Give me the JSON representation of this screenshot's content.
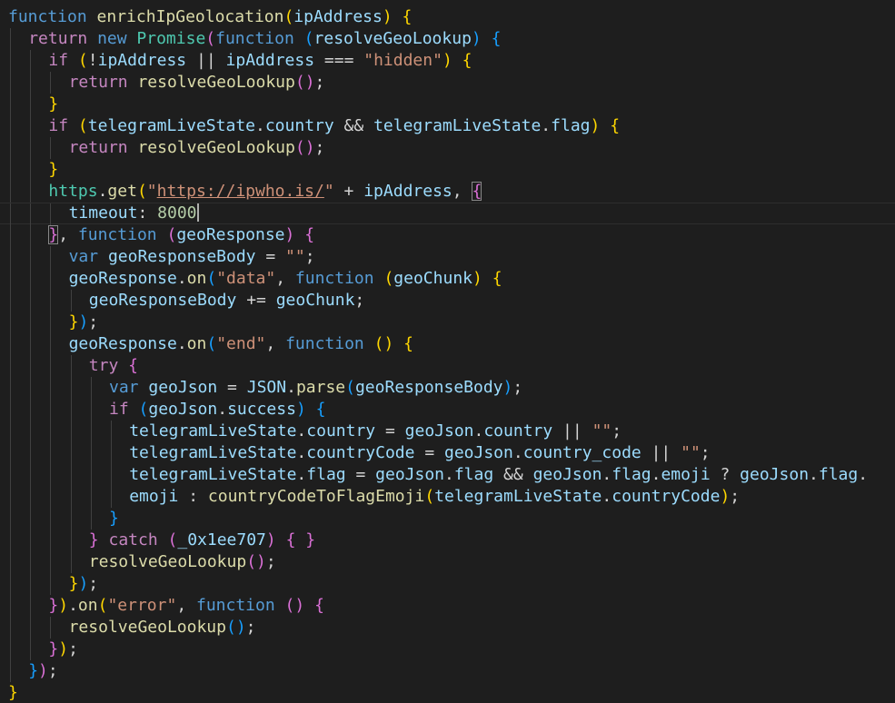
{
  "colors": {
    "background": "#1e1e1e",
    "keyword": "#569cd6",
    "control": "#c586c0",
    "function": "#dcdcaa",
    "variable": "#9cdcfe",
    "string": "#ce9178",
    "number": "#b5cea8",
    "class": "#4ec9b0",
    "plain": "#d4d4d4",
    "bracket1": "#ffd700",
    "bracket2": "#da70d6",
    "bracket3": "#179fff"
  },
  "editor": {
    "cursor_line": 10,
    "lines": [
      {
        "indent": 0,
        "tokens": [
          [
            "function",
            "keyword"
          ],
          [
            " ",
            "plain"
          ],
          [
            "enrichIpGeolocation",
            "function"
          ],
          [
            "(",
            "bracket1"
          ],
          [
            "ipAddress",
            "variable"
          ],
          [
            ")",
            "bracket1"
          ],
          [
            " ",
            "plain"
          ],
          [
            "{",
            "bracket1"
          ]
        ]
      },
      {
        "indent": 1,
        "tokens": [
          [
            "return",
            "control"
          ],
          [
            " ",
            "plain"
          ],
          [
            "new",
            "keyword"
          ],
          [
            " ",
            "plain"
          ],
          [
            "Promise",
            "class"
          ],
          [
            "(",
            "bracket2"
          ],
          [
            "function",
            "keyword"
          ],
          [
            " ",
            "plain"
          ],
          [
            "(",
            "bracket3"
          ],
          [
            "resolveGeoLookup",
            "variable"
          ],
          [
            ")",
            "bracket3"
          ],
          [
            " ",
            "plain"
          ],
          [
            "{",
            "bracket3"
          ]
        ]
      },
      {
        "indent": 2,
        "tokens": [
          [
            "if",
            "control"
          ],
          [
            " ",
            "plain"
          ],
          [
            "(",
            "bracket1"
          ],
          [
            "!",
            "plain"
          ],
          [
            "ipAddress",
            "variable"
          ],
          [
            " || ",
            "plain"
          ],
          [
            "ipAddress",
            "variable"
          ],
          [
            " === ",
            "plain"
          ],
          [
            "\"hidden\"",
            "string"
          ],
          [
            ")",
            "bracket1"
          ],
          [
            " ",
            "plain"
          ],
          [
            "{",
            "bracket1"
          ]
        ]
      },
      {
        "indent": 3,
        "tokens": [
          [
            "return",
            "control"
          ],
          [
            " ",
            "plain"
          ],
          [
            "resolveGeoLookup",
            "function"
          ],
          [
            "()",
            "bracket2"
          ],
          [
            ";",
            "plain"
          ]
        ]
      },
      {
        "indent": 2,
        "tokens": [
          [
            "}",
            "bracket1"
          ]
        ]
      },
      {
        "indent": 2,
        "tokens": [
          [
            "if",
            "control"
          ],
          [
            " ",
            "plain"
          ],
          [
            "(",
            "bracket1"
          ],
          [
            "telegramLiveState",
            "variable"
          ],
          [
            ".",
            "plain"
          ],
          [
            "country",
            "variable"
          ],
          [
            " && ",
            "plain"
          ],
          [
            "telegramLiveState",
            "variable"
          ],
          [
            ".",
            "plain"
          ],
          [
            "flag",
            "variable"
          ],
          [
            ")",
            "bracket1"
          ],
          [
            " ",
            "plain"
          ],
          [
            "{",
            "bracket1"
          ]
        ]
      },
      {
        "indent": 3,
        "tokens": [
          [
            "return",
            "control"
          ],
          [
            " ",
            "plain"
          ],
          [
            "resolveGeoLookup",
            "function"
          ],
          [
            "()",
            "bracket2"
          ],
          [
            ";",
            "plain"
          ]
        ]
      },
      {
        "indent": 2,
        "tokens": [
          [
            "}",
            "bracket1"
          ]
        ]
      },
      {
        "indent": 2,
        "tokens": [
          [
            "https",
            "class"
          ],
          [
            ".",
            "plain"
          ],
          [
            "get",
            "function"
          ],
          [
            "(",
            "bracket1"
          ],
          [
            "\"",
            "string"
          ],
          [
            "https://ipwho.is/",
            "string-underline"
          ],
          [
            "\"",
            "string"
          ],
          [
            " + ",
            "plain"
          ],
          [
            "ipAddress",
            "variable"
          ],
          [
            ", ",
            "plain"
          ],
          [
            "{",
            "bracket2-box"
          ]
        ]
      },
      {
        "indent": 3,
        "tokens": [
          [
            "timeout",
            "variable"
          ],
          [
            ": ",
            "plain"
          ],
          [
            "8000",
            "number"
          ]
        ]
      },
      {
        "indent": 2,
        "tokens": [
          [
            "}",
            "bracket2-box"
          ],
          [
            ", ",
            "plain"
          ],
          [
            "function",
            "keyword"
          ],
          [
            " ",
            "plain"
          ],
          [
            "(",
            "bracket2"
          ],
          [
            "geoResponse",
            "variable"
          ],
          [
            ")",
            "bracket2"
          ],
          [
            " ",
            "plain"
          ],
          [
            "{",
            "bracket2"
          ]
        ]
      },
      {
        "indent": 3,
        "tokens": [
          [
            "var",
            "keyword"
          ],
          [
            " ",
            "plain"
          ],
          [
            "geoResponseBody",
            "variable"
          ],
          [
            " = ",
            "plain"
          ],
          [
            "\"\"",
            "string"
          ],
          [
            ";",
            "plain"
          ]
        ]
      },
      {
        "indent": 3,
        "tokens": [
          [
            "geoResponse",
            "variable"
          ],
          [
            ".",
            "plain"
          ],
          [
            "on",
            "function"
          ],
          [
            "(",
            "bracket3"
          ],
          [
            "\"data\"",
            "string"
          ],
          [
            ", ",
            "plain"
          ],
          [
            "function",
            "keyword"
          ],
          [
            " ",
            "plain"
          ],
          [
            "(",
            "bracket1"
          ],
          [
            "geoChunk",
            "variable"
          ],
          [
            ")",
            "bracket1"
          ],
          [
            " ",
            "plain"
          ],
          [
            "{",
            "bracket1"
          ]
        ]
      },
      {
        "indent": 4,
        "tokens": [
          [
            "geoResponseBody",
            "variable"
          ],
          [
            " += ",
            "plain"
          ],
          [
            "geoChunk",
            "variable"
          ],
          [
            ";",
            "plain"
          ]
        ]
      },
      {
        "indent": 3,
        "tokens": [
          [
            "}",
            "bracket1"
          ],
          [
            ")",
            "bracket3"
          ],
          [
            ";",
            "plain"
          ]
        ]
      },
      {
        "indent": 3,
        "tokens": [
          [
            "geoResponse",
            "variable"
          ],
          [
            ".",
            "plain"
          ],
          [
            "on",
            "function"
          ],
          [
            "(",
            "bracket3"
          ],
          [
            "\"end\"",
            "string"
          ],
          [
            ", ",
            "plain"
          ],
          [
            "function",
            "keyword"
          ],
          [
            " ",
            "plain"
          ],
          [
            "()",
            "bracket1"
          ],
          [
            " ",
            "plain"
          ],
          [
            "{",
            "bracket1"
          ]
        ]
      },
      {
        "indent": 4,
        "tokens": [
          [
            "try",
            "control"
          ],
          [
            " ",
            "plain"
          ],
          [
            "{",
            "bracket2"
          ]
        ]
      },
      {
        "indent": 5,
        "tokens": [
          [
            "var",
            "keyword"
          ],
          [
            " ",
            "plain"
          ],
          [
            "geoJson",
            "variable"
          ],
          [
            " = ",
            "plain"
          ],
          [
            "JSON",
            "variable"
          ],
          [
            ".",
            "plain"
          ],
          [
            "parse",
            "function"
          ],
          [
            "(",
            "bracket3"
          ],
          [
            "geoResponseBody",
            "variable"
          ],
          [
            ")",
            "bracket3"
          ],
          [
            ";",
            "plain"
          ]
        ]
      },
      {
        "indent": 5,
        "tokens": [
          [
            "if",
            "control"
          ],
          [
            " ",
            "plain"
          ],
          [
            "(",
            "bracket3"
          ],
          [
            "geoJson",
            "variable"
          ],
          [
            ".",
            "plain"
          ],
          [
            "success",
            "variable"
          ],
          [
            ")",
            "bracket3"
          ],
          [
            " ",
            "plain"
          ],
          [
            "{",
            "bracket3"
          ]
        ]
      },
      {
        "indent": 6,
        "tokens": [
          [
            "telegramLiveState",
            "variable"
          ],
          [
            ".",
            "plain"
          ],
          [
            "country",
            "variable"
          ],
          [
            " = ",
            "plain"
          ],
          [
            "geoJson",
            "variable"
          ],
          [
            ".",
            "plain"
          ],
          [
            "country",
            "variable"
          ],
          [
            " || ",
            "plain"
          ],
          [
            "\"\"",
            "string"
          ],
          [
            ";",
            "plain"
          ]
        ]
      },
      {
        "indent": 6,
        "tokens": [
          [
            "telegramLiveState",
            "variable"
          ],
          [
            ".",
            "plain"
          ],
          [
            "countryCode",
            "variable"
          ],
          [
            " = ",
            "plain"
          ],
          [
            "geoJson",
            "variable"
          ],
          [
            ".",
            "plain"
          ],
          [
            "country_code",
            "variable"
          ],
          [
            " || ",
            "plain"
          ],
          [
            "\"\"",
            "string"
          ],
          [
            ";",
            "plain"
          ]
        ]
      },
      {
        "indent": 6,
        "tokens": [
          [
            "telegramLiveState",
            "variable"
          ],
          [
            ".",
            "plain"
          ],
          [
            "flag",
            "variable"
          ],
          [
            " = ",
            "plain"
          ],
          [
            "geoJson",
            "variable"
          ],
          [
            ".",
            "plain"
          ],
          [
            "flag",
            "variable"
          ],
          [
            " && ",
            "plain"
          ],
          [
            "geoJson",
            "variable"
          ],
          [
            ".",
            "plain"
          ],
          [
            "flag",
            "variable"
          ],
          [
            ".",
            "plain"
          ],
          [
            "emoji",
            "variable"
          ],
          [
            " ? ",
            "plain"
          ],
          [
            "geoJson",
            "variable"
          ],
          [
            ".",
            "plain"
          ],
          [
            "flag",
            "variable"
          ],
          [
            ".",
            "plain"
          ]
        ]
      },
      {
        "indent": 6,
        "tokens": [
          [
            "emoji",
            "variable"
          ],
          [
            " : ",
            "plain"
          ],
          [
            "countryCodeToFlagEmoji",
            "function"
          ],
          [
            "(",
            "bracket1"
          ],
          [
            "telegramLiveState",
            "variable"
          ],
          [
            ".",
            "plain"
          ],
          [
            "countryCode",
            "variable"
          ],
          [
            ")",
            "bracket1"
          ],
          [
            ";",
            "plain"
          ]
        ]
      },
      {
        "indent": 5,
        "tokens": [
          [
            "}",
            "bracket3"
          ]
        ]
      },
      {
        "indent": 4,
        "tokens": [
          [
            "}",
            "bracket2"
          ],
          [
            " ",
            "plain"
          ],
          [
            "catch",
            "control"
          ],
          [
            " ",
            "plain"
          ],
          [
            "(",
            "bracket2"
          ],
          [
            "_0x1ee707",
            "variable"
          ],
          [
            ")",
            "bracket2"
          ],
          [
            " ",
            "plain"
          ],
          [
            "{ }",
            "bracket2"
          ]
        ]
      },
      {
        "indent": 4,
        "tokens": [
          [
            "resolveGeoLookup",
            "function"
          ],
          [
            "()",
            "bracket2"
          ],
          [
            ";",
            "plain"
          ]
        ]
      },
      {
        "indent": 3,
        "tokens": [
          [
            "}",
            "bracket1"
          ],
          [
            ")",
            "bracket3"
          ],
          [
            ";",
            "plain"
          ]
        ]
      },
      {
        "indent": 2,
        "tokens": [
          [
            "}",
            "bracket2"
          ],
          [
            ")",
            "bracket1"
          ],
          [
            ".",
            "plain"
          ],
          [
            "on",
            "function"
          ],
          [
            "(",
            "bracket1"
          ],
          [
            "\"error\"",
            "string"
          ],
          [
            ", ",
            "plain"
          ],
          [
            "function",
            "keyword"
          ],
          [
            " ",
            "plain"
          ],
          [
            "()",
            "bracket2"
          ],
          [
            " ",
            "plain"
          ],
          [
            "{",
            "bracket2"
          ]
        ]
      },
      {
        "indent": 3,
        "tokens": [
          [
            "resolveGeoLookup",
            "function"
          ],
          [
            "()",
            "bracket3"
          ],
          [
            ";",
            "plain"
          ]
        ]
      },
      {
        "indent": 2,
        "tokens": [
          [
            "}",
            "bracket2"
          ],
          [
            ")",
            "bracket1"
          ],
          [
            ";",
            "plain"
          ]
        ]
      },
      {
        "indent": 1,
        "tokens": [
          [
            "}",
            "bracket3"
          ],
          [
            ")",
            "bracket2"
          ],
          [
            ";",
            "plain"
          ]
        ]
      },
      {
        "indent": 0,
        "tokens": [
          [
            "}",
            "bracket1"
          ]
        ]
      }
    ]
  }
}
